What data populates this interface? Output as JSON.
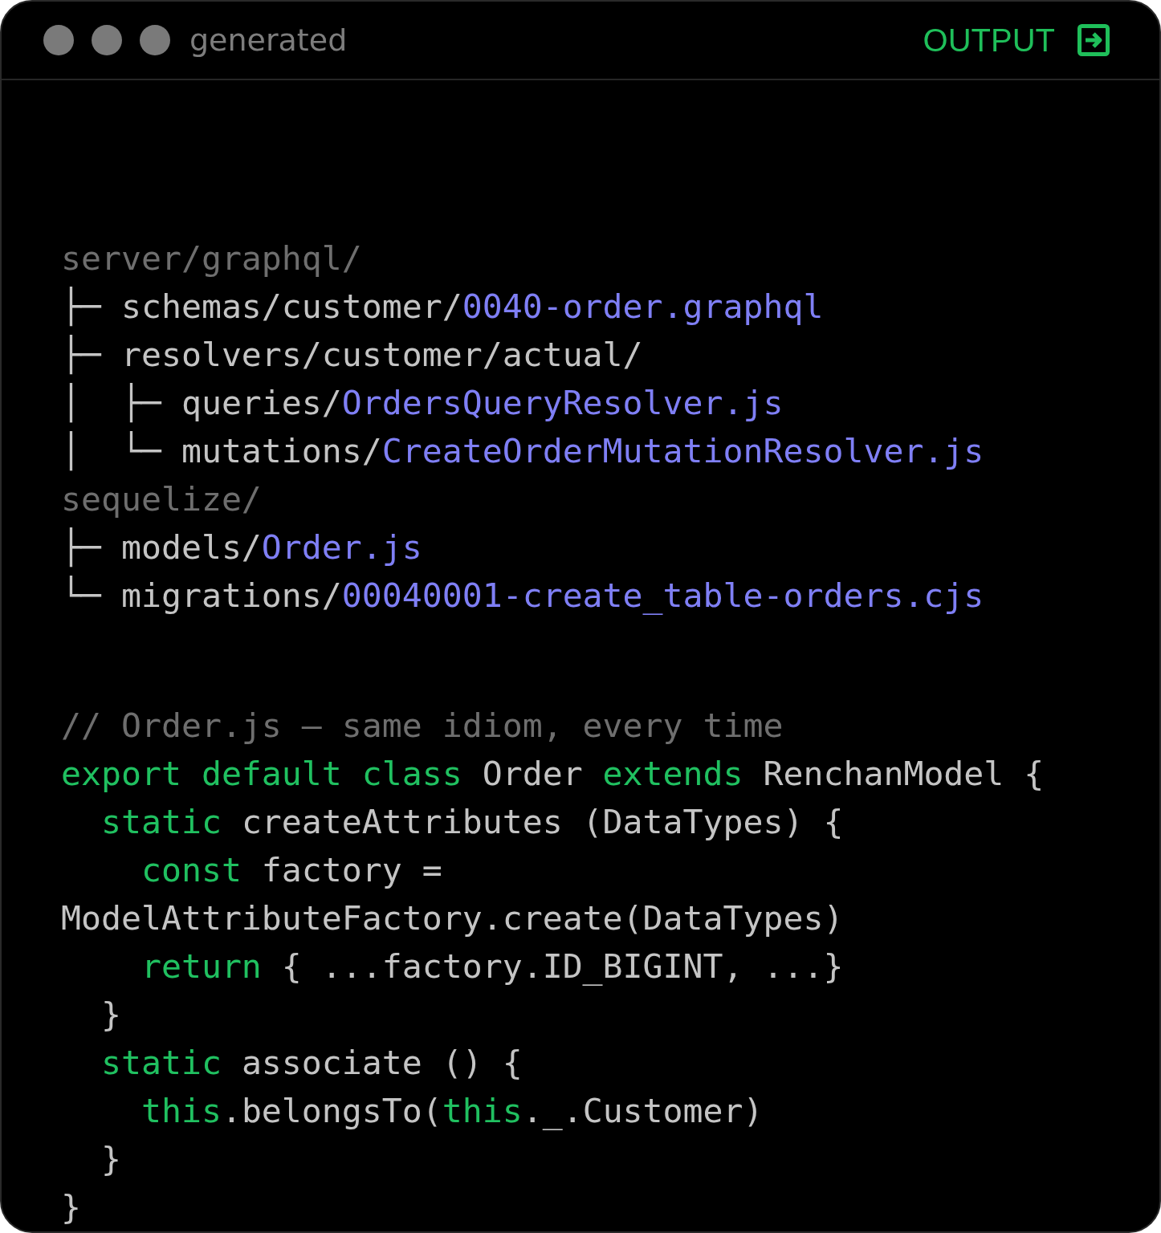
{
  "window": {
    "title": "generated",
    "mode_label": "OUTPUT"
  },
  "tree": [
    {
      "tokens": [
        {
          "kind": "root",
          "text": "server/graphql/"
        }
      ]
    },
    {
      "tokens": [
        {
          "kind": "plain",
          "text": "├─ schemas/customer/"
        },
        {
          "kind": "file",
          "text": "0040-order.graphql"
        }
      ]
    },
    {
      "tokens": [
        {
          "kind": "plain",
          "text": "├─ resolvers/customer/actual/"
        }
      ]
    },
    {
      "tokens": [
        {
          "kind": "plain",
          "text": "│  ├─ queries/"
        },
        {
          "kind": "file",
          "text": "OrdersQueryResolver.js"
        }
      ]
    },
    {
      "tokens": [
        {
          "kind": "plain",
          "text": "│  └─ mutations/"
        },
        {
          "kind": "file",
          "text": "CreateOrderMutationResolver.js"
        }
      ]
    },
    {
      "tokens": [
        {
          "kind": "root",
          "text": "sequelize/"
        }
      ]
    },
    {
      "tokens": [
        {
          "kind": "plain",
          "text": "├─ models/"
        },
        {
          "kind": "file",
          "text": "Order.js"
        }
      ]
    },
    {
      "tokens": [
        {
          "kind": "plain",
          "text": "└─ migrations/"
        },
        {
          "kind": "file",
          "text": "00040001-create_table-orders.cjs"
        }
      ]
    }
  ],
  "code": [
    {
      "tokens": [
        {
          "kind": "comment",
          "text": "// Order.js — same idiom, every time"
        }
      ]
    },
    {
      "tokens": [
        {
          "kind": "keyword",
          "text": "export default class"
        },
        {
          "kind": "plain",
          "text": " Order "
        },
        {
          "kind": "keyword",
          "text": "extends"
        },
        {
          "kind": "plain",
          "text": " RenchanModel {"
        }
      ]
    },
    {
      "tokens": [
        {
          "kind": "keyword",
          "text": "  static"
        },
        {
          "kind": "plain",
          "text": " createAttributes (DataTypes) {"
        }
      ]
    },
    {
      "tokens": [
        {
          "kind": "keyword",
          "text": "    const"
        },
        {
          "kind": "plain",
          "text": " factory ="
        }
      ]
    },
    {
      "tokens": [
        {
          "kind": "plain",
          "text": "ModelAttributeFactory.create(DataTypes)"
        }
      ]
    },
    {
      "tokens": [
        {
          "kind": "keyword",
          "text": "    return"
        },
        {
          "kind": "plain",
          "text": " { ...factory.ID_BIGINT, ...}"
        }
      ]
    },
    {
      "tokens": [
        {
          "kind": "plain",
          "text": "  }"
        }
      ]
    },
    {
      "tokens": [
        {
          "kind": "keyword",
          "text": "  static"
        },
        {
          "kind": "plain",
          "text": " associate () {"
        }
      ]
    },
    {
      "tokens": [
        {
          "kind": "keyword",
          "text": "    this"
        },
        {
          "kind": "plain",
          "text": ".belongsTo("
        },
        {
          "kind": "keyword",
          "text": "this"
        },
        {
          "kind": "plain",
          "text": "._.Customer)"
        }
      ]
    },
    {
      "tokens": [
        {
          "kind": "plain",
          "text": "  }"
        }
      ]
    },
    {
      "tokens": [
        {
          "kind": "plain",
          "text": "}"
        }
      ]
    }
  ]
}
